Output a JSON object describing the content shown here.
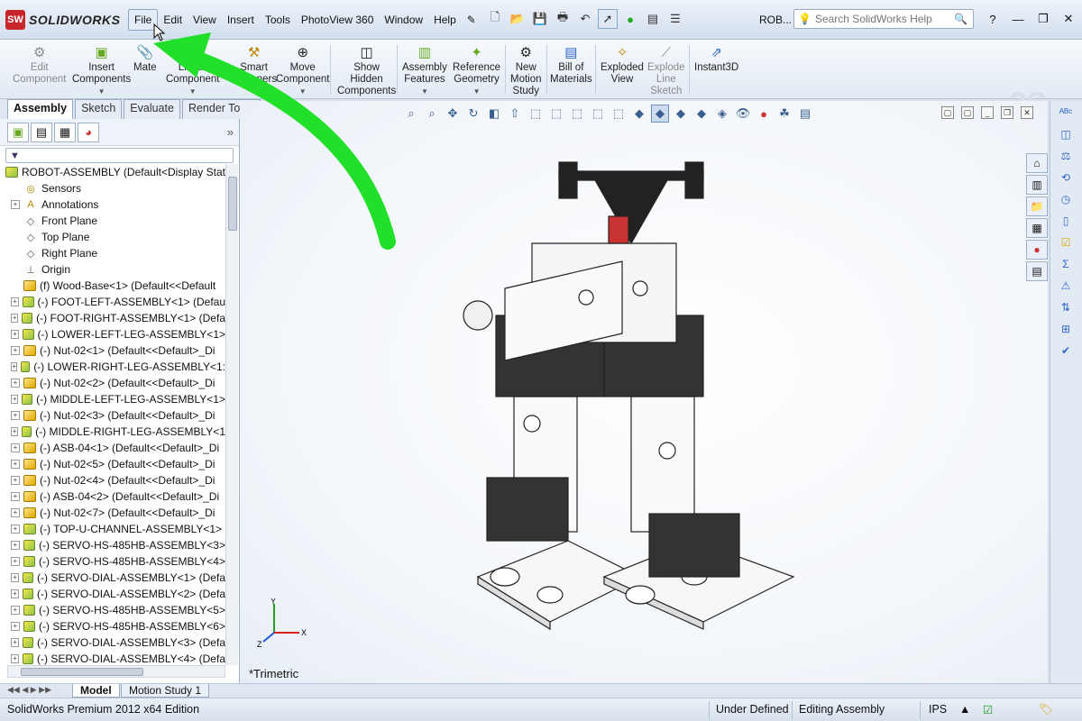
{
  "app": {
    "name": "SOLIDWORKS",
    "logo_letters": "SW",
    "document": "ROB..."
  },
  "menu": [
    "File",
    "Edit",
    "View",
    "Insert",
    "Tools",
    "PhotoView 360",
    "Window",
    "Help"
  ],
  "search": {
    "placeholder": "Search SolidWorks Help"
  },
  "commands": [
    {
      "label": "Edit\nComponent",
      "icon": "edit-component-icon",
      "disabled": true
    },
    {
      "label": "Insert\nComponents",
      "icon": "insert-components-icon",
      "disabled": false
    },
    {
      "label": "Mate",
      "icon": "mate-icon",
      "disabled": false
    },
    {
      "label": "Linear\nComponent",
      "icon": "linear-pattern-icon",
      "disabled": false
    },
    {
      "label": "Smart\nFasteners",
      "icon": "smart-fasteners-icon",
      "disabled": false
    },
    {
      "label": "Move\nComponent",
      "icon": "move-component-icon",
      "disabled": false
    },
    {
      "label": "Show\nHidden\nComponents",
      "icon": "show-hidden-icon",
      "disabled": false
    },
    {
      "label": "Assembly\nFeatures",
      "icon": "assembly-features-icon",
      "disabled": false
    },
    {
      "label": "Reference\nGeometry",
      "icon": "reference-geometry-icon",
      "disabled": false
    },
    {
      "label": "New\nMotion\nStudy",
      "icon": "motion-study-icon",
      "disabled": false
    },
    {
      "label": "Bill of\nMaterials",
      "icon": "bom-icon",
      "disabled": false
    },
    {
      "label": "Exploded\nView",
      "icon": "exploded-view-icon",
      "disabled": false
    },
    {
      "label": "Explode\nLine\nSketch",
      "icon": "explode-line-icon",
      "disabled": true
    },
    {
      "label": "Instant3D",
      "icon": "instant3d-icon",
      "disabled": false
    }
  ],
  "tabs": [
    "Assembly",
    "Sketch",
    "Evaluate",
    "Render Tools"
  ],
  "active_tab": "Assembly",
  "tree": {
    "root": "ROBOT-ASSEMBLY  (Default<Display Stat",
    "items": [
      {
        "label": "Sensors",
        "type": "sensor",
        "expand": false
      },
      {
        "label": "Annotations",
        "type": "annotation",
        "expand": true
      },
      {
        "label": "Front Plane",
        "type": "plane",
        "expand": false
      },
      {
        "label": "Top Plane",
        "type": "plane",
        "expand": false
      },
      {
        "label": "Right Plane",
        "type": "plane",
        "expand": false
      },
      {
        "label": "Origin",
        "type": "origin",
        "expand": false
      },
      {
        "label": "(f) Wood-Base<1> (Default<<Default",
        "type": "part",
        "expand": false
      },
      {
        "label": "(-) FOOT-LEFT-ASSEMBLY<1> (Defau",
        "type": "asm",
        "expand": true
      },
      {
        "label": "(-) FOOT-RIGHT-ASSEMBLY<1> (Defa",
        "type": "asm",
        "expand": true
      },
      {
        "label": "(-) LOWER-LEFT-LEG-ASSEMBLY<1>",
        "type": "asm",
        "expand": true
      },
      {
        "label": "(-) Nut-02<1> (Default<<Default>_Di",
        "type": "part",
        "expand": true
      },
      {
        "label": "(-) LOWER-RIGHT-LEG-ASSEMBLY<1:",
        "type": "asm",
        "expand": true
      },
      {
        "label": "(-) Nut-02<2> (Default<<Default>_Di",
        "type": "part",
        "expand": true
      },
      {
        "label": "(-) MIDDLE-LEFT-LEG-ASSEMBLY<1>",
        "type": "asm",
        "expand": true
      },
      {
        "label": "(-) Nut-02<3> (Default<<Default>_Di",
        "type": "part",
        "expand": true
      },
      {
        "label": "(-) MIDDLE-RIGHT-LEG-ASSEMBLY<1",
        "type": "asm",
        "expand": true
      },
      {
        "label": "(-) ASB-04<1> (Default<<Default>_Di",
        "type": "part",
        "expand": true
      },
      {
        "label": "(-) Nut-02<5> (Default<<Default>_Di",
        "type": "part",
        "expand": true
      },
      {
        "label": "(-) Nut-02<4> (Default<<Default>_Di",
        "type": "part",
        "expand": true
      },
      {
        "label": "(-) ASB-04<2> (Default<<Default>_Di",
        "type": "part",
        "expand": true
      },
      {
        "label": "(-) Nut-02<7> (Default<<Default>_Di",
        "type": "part",
        "expand": true
      },
      {
        "label": "(-) TOP-U-CHANNEL-ASSEMBLY<1>",
        "type": "asm",
        "expand": true
      },
      {
        "label": "(-) SERVO-HS-485HB-ASSEMBLY<3>",
        "type": "asm",
        "expand": true
      },
      {
        "label": "(-) SERVO-HS-485HB-ASSEMBLY<4>",
        "type": "asm",
        "expand": true
      },
      {
        "label": "(-) SERVO-DIAL-ASSEMBLY<1> (Defa",
        "type": "asm",
        "expand": true
      },
      {
        "label": "(-) SERVO-DIAL-ASSEMBLY<2> (Defa",
        "type": "asm",
        "expand": true
      },
      {
        "label": "(-) SERVO-HS-485HB-ASSEMBLY<5>",
        "type": "asm",
        "expand": true
      },
      {
        "label": "(-) SERVO-HS-485HB-ASSEMBLY<6>",
        "type": "asm",
        "expand": true
      },
      {
        "label": "(-) SERVO-DIAL-ASSEMBLY<3> (Defa",
        "type": "asm",
        "expand": true
      },
      {
        "label": "(-) SERVO-DIAL-ASSEMBLY<4> (Defa",
        "type": "asm",
        "expand": true
      }
    ]
  },
  "view": {
    "orientation": "*Trimetric",
    "axes": {
      "x": "X",
      "y": "Y",
      "z": "Z"
    }
  },
  "model_tabs": [
    "Model",
    "Motion Study 1"
  ],
  "status": {
    "edition": "SolidWorks Premium 2012 x64 Edition",
    "state": "Under Defined",
    "mode": "Editing Assembly",
    "units": "IPS"
  },
  "colors": {
    "highlight_arrow": "#22e02a",
    "brand": "#c8262b"
  }
}
